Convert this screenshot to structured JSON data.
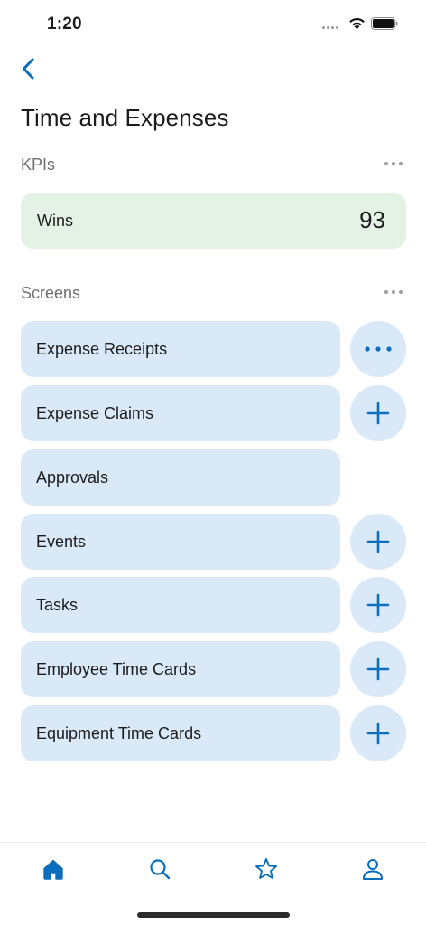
{
  "status_bar": {
    "time": "1:20"
  },
  "navigation": {
    "back_label": "Back"
  },
  "page": {
    "title": "Time and Expenses"
  },
  "kpis": {
    "header": "KPIs",
    "items": [
      {
        "label": "Wins",
        "value": "93"
      }
    ]
  },
  "screens": {
    "header": "Screens",
    "items": [
      {
        "label": "Expense Receipts",
        "action": "more"
      },
      {
        "label": "Expense Claims",
        "action": "add"
      },
      {
        "label": "Approvals",
        "action": "none"
      },
      {
        "label": "Events",
        "action": "add"
      },
      {
        "label": "Tasks",
        "action": "add"
      },
      {
        "label": "Employee Time Cards",
        "action": "add"
      },
      {
        "label": "Equipment Time Cards",
        "action": "add"
      }
    ]
  },
  "tab_bar": {
    "tabs": [
      {
        "name": "home",
        "icon": "home-icon",
        "active": true
      },
      {
        "name": "search",
        "icon": "search-icon",
        "active": false
      },
      {
        "name": "favorites",
        "icon": "star-icon",
        "active": false
      },
      {
        "name": "profile",
        "icon": "person-icon",
        "active": false
      }
    ]
  },
  "colors": {
    "accent": "#0a6ebd",
    "kpi_background": "#e3f2e4",
    "screen_background": "#d9e9f7",
    "secondary_text": "#6e6e73"
  }
}
